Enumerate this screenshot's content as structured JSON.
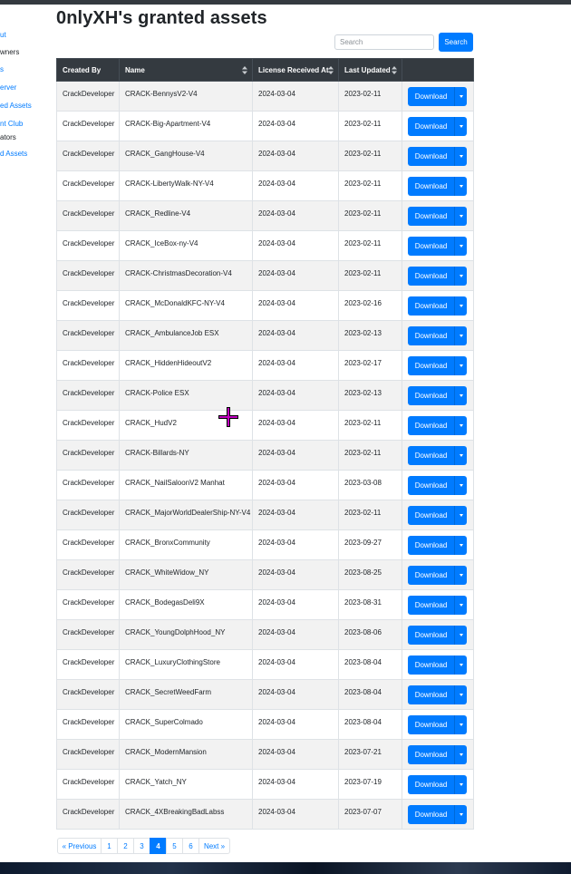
{
  "sidebar": {
    "items": [
      {
        "label": "ut",
        "type": "link"
      },
      {
        "label": "wners",
        "type": "header"
      },
      {
        "label": "s",
        "type": "link"
      },
      {
        "label": "erver",
        "type": "link"
      },
      {
        "label": "ed Assets",
        "type": "link"
      },
      {
        "label": "nt Club",
        "type": "link"
      },
      {
        "label": "ators",
        "type": "header"
      },
      {
        "label": "d Assets",
        "type": "link"
      }
    ]
  },
  "page": {
    "title": "0nlyXH's granted assets"
  },
  "search": {
    "placeholder": "Search",
    "button_label": "Search"
  },
  "table": {
    "columns": [
      "Created By",
      "Name",
      "License Received At",
      "Last Updated"
    ],
    "download_label": "Download",
    "rows": [
      {
        "created_by": "CrackDeveloper",
        "name": "CRACK-BennysV2-V4",
        "received": "2024-03-04",
        "updated": "2023-02-11"
      },
      {
        "created_by": "CrackDeveloper",
        "name": "CRACK-Big-Apartment-V4",
        "received": "2024-03-04",
        "updated": "2023-02-11"
      },
      {
        "created_by": "CrackDeveloper",
        "name": "CRACK_GangHouse-V4",
        "received": "2024-03-04",
        "updated": "2023-02-11"
      },
      {
        "created_by": "CrackDeveloper",
        "name": "CRACK-LibertyWalk-NY-V4",
        "received": "2024-03-04",
        "updated": "2023-02-11"
      },
      {
        "created_by": "CrackDeveloper",
        "name": "CRACK_Redline-V4",
        "received": "2024-03-04",
        "updated": "2023-02-11"
      },
      {
        "created_by": "CrackDeveloper",
        "name": "CRACK_IceBox-ny-V4",
        "received": "2024-03-04",
        "updated": "2023-02-11"
      },
      {
        "created_by": "CrackDeveloper",
        "name": "CRACK-ChristmasDecoration-V4",
        "received": "2024-03-04",
        "updated": "2023-02-11"
      },
      {
        "created_by": "CrackDeveloper",
        "name": "CRACK_McDonaldKFC-NY-V4",
        "received": "2024-03-04",
        "updated": "2023-02-16"
      },
      {
        "created_by": "CrackDeveloper",
        "name": "CRACK_AmbulanceJob ESX",
        "received": "2024-03-04",
        "updated": "2023-02-13"
      },
      {
        "created_by": "CrackDeveloper",
        "name": "CRACK_HiddenHideoutV2",
        "received": "2024-03-04",
        "updated": "2023-02-17"
      },
      {
        "created_by": "CrackDeveloper",
        "name": "CRACK-Police ESX",
        "received": "2024-03-04",
        "updated": "2023-02-13"
      },
      {
        "created_by": "CrackDeveloper",
        "name": "CRACK_HudV2",
        "received": "2024-03-04",
        "updated": "2023-02-11"
      },
      {
        "created_by": "CrackDeveloper",
        "name": "CRACK-Billards-NY",
        "received": "2024-03-04",
        "updated": "2023-02-11"
      },
      {
        "created_by": "CrackDeveloper",
        "name": "CRACK_NailSaloonV2 Manhat",
        "received": "2024-03-04",
        "updated": "2023-03-08"
      },
      {
        "created_by": "CrackDeveloper",
        "name": "CRACK_MajorWorldDealerShip-NY-V4",
        "received": "2024-03-04",
        "updated": "2023-02-11"
      },
      {
        "created_by": "CrackDeveloper",
        "name": "CRACK_BronxCommunity",
        "received": "2024-03-04",
        "updated": "2023-09-27"
      },
      {
        "created_by": "CrackDeveloper",
        "name": "CRACK_WhiteWidow_NY",
        "received": "2024-03-04",
        "updated": "2023-08-25"
      },
      {
        "created_by": "CrackDeveloper",
        "name": "CRACK_BodegasDeli9X",
        "received": "2024-03-04",
        "updated": "2023-08-31"
      },
      {
        "created_by": "CrackDeveloper",
        "name": "CRACK_YoungDolphHood_NY",
        "received": "2024-03-04",
        "updated": "2023-08-06"
      },
      {
        "created_by": "CrackDeveloper",
        "name": "CRACK_LuxuryClothingStore",
        "received": "2024-03-04",
        "updated": "2023-08-04"
      },
      {
        "created_by": "CrackDeveloper",
        "name": "CRACK_SecretWeedFarm",
        "received": "2024-03-04",
        "updated": "2023-08-04"
      },
      {
        "created_by": "CrackDeveloper",
        "name": "CRACK_SuperColmado",
        "received": "2024-03-04",
        "updated": "2023-08-04"
      },
      {
        "created_by": "CrackDeveloper",
        "name": "CRACK_ModernMansion",
        "received": "2024-03-04",
        "updated": "2023-07-21"
      },
      {
        "created_by": "CrackDeveloper",
        "name": "CRACK_Yatch_NY",
        "received": "2024-03-04",
        "updated": "2023-07-19"
      },
      {
        "created_by": "CrackDeveloper",
        "name": "CRACK_4XBreakingBadLabss",
        "received": "2024-03-04",
        "updated": "2023-07-07"
      }
    ]
  },
  "pagination": {
    "prev": "« Previous",
    "pages": [
      "1",
      "2",
      "3",
      "4",
      "5",
      "6"
    ],
    "active_page": "4",
    "next": "Next »"
  },
  "colors": {
    "accent": "#007bff",
    "header_bg": "#343a40",
    "cursor": "#b000b0"
  }
}
